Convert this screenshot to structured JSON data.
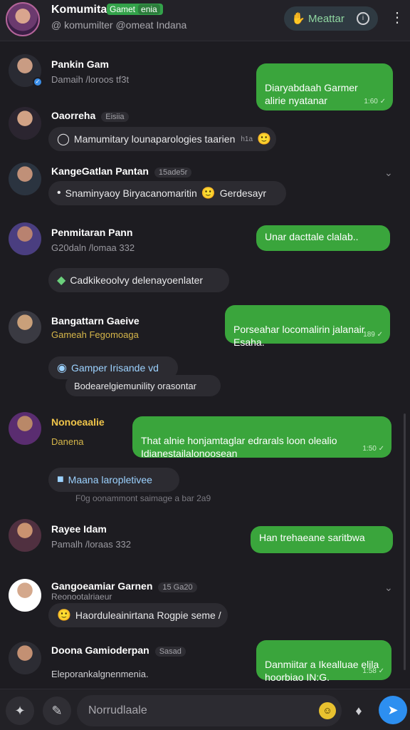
{
  "header": {
    "title": "Komumitar",
    "badge": "Gamet",
    "badge2": "enia",
    "subtitle": "@ komumilter @omeat Indana",
    "action_label": "Meattar",
    "action_icon": "hand-wave-icon",
    "info_icon": "info-icon",
    "more_icon": "more-vertical-icon"
  },
  "messages": [
    {
      "name": "Pankin Gam",
      "sub": "Damaih /loroos tf3t",
      "bubble": "Diaryabdaah Garmer\nalirie nyatanar",
      "meta": "1:60 ✓"
    },
    {
      "name": "Oaorreha",
      "tag": "Eisiia",
      "pill": "Mamumitary lounaparologies taarien",
      "pill_meta": "h1a"
    },
    {
      "name": "KangeGatlan Pantan",
      "tag": "15ade5r",
      "pill": "Snaminyaoy Biryacanomaritin",
      "pill_end": "Gerdesayr"
    },
    {
      "name": "Penmitaran Pann",
      "sub": "G20daln /lomaa 332",
      "bubble": "Unar dacttale clalab.."
    },
    {
      "pill": "Cadkikeoolvy delenayoenlater"
    },
    {
      "name": "Bangattarn Gaeive",
      "sub": "Gameah Fegomoaga",
      "bubble": "Porseahar locomalirin jalanair\nEsaha.",
      "meta": "189 ✓"
    },
    {
      "pill_blue": "Gamper Irisande vd",
      "pill": "Bodearelgiemunility orasontar"
    },
    {
      "name": "Nonoeaalie",
      "sub": "Danena",
      "bubble": "That alnie honjamtaglar edrarals loon olealio\nIdianestailalonoosean",
      "meta": "1:50 ✓"
    },
    {
      "pill_blue": "Maana laropletivee",
      "note": "F0g oonammont saimage a bar 2a9"
    },
    {
      "name": "Rayee Idam",
      "sub": "Pamalh /loraas 332",
      "bubble": "Han trehaeane saritbwa"
    },
    {
      "name": "Gangoeamiar Garnen",
      "tag": "15 Ga20",
      "sub": "Reonootalriaeur",
      "pill": "Haorduleainirtana Rogpie seme /"
    },
    {
      "name": "Doona Gamioderpan",
      "tag": "Sasad",
      "sub": "Eleporankalgnenmenia.",
      "bubble": "Danmiitar a Ikealluae elila\nhoorbiao IN:G.",
      "meta": "1:58 ✓"
    }
  ],
  "bottom": {
    "placeholder": "Norrudlaale",
    "send_icon": "send-icon",
    "attach_icon": "attach-icon",
    "edit_icon": "edit-icon",
    "mic_icon": "microphone-icon"
  },
  "colors": {
    "accent_green": "#3aa53c",
    "send_blue": "#2d8ff0",
    "background": "#1d1c21"
  }
}
